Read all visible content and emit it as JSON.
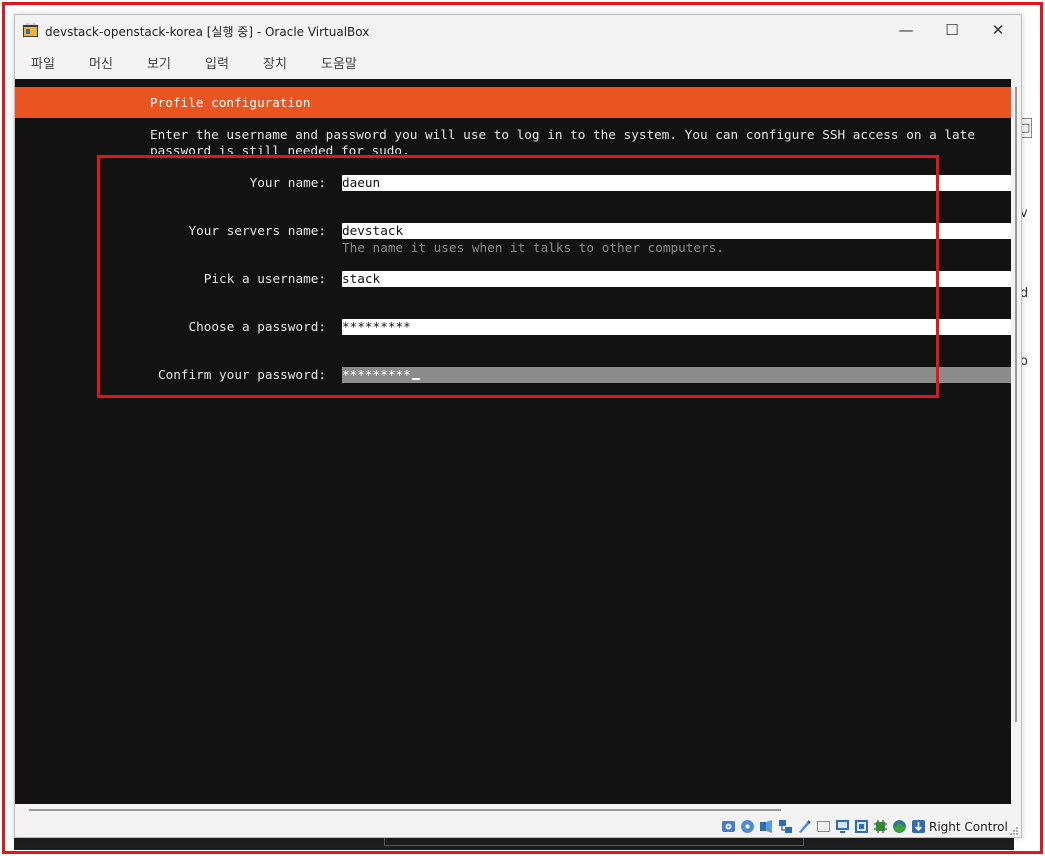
{
  "window": {
    "title": "devstack-openstack-korea [실행 중] - Oracle VirtualBox",
    "controls": {
      "minimize": "—",
      "maximize": "☐",
      "close": "✕"
    }
  },
  "menubar": {
    "items": [
      {
        "id": "file",
        "label": "파일"
      },
      {
        "id": "machine",
        "label": "머신"
      },
      {
        "id": "view",
        "label": "보기"
      },
      {
        "id": "input",
        "label": "입력"
      },
      {
        "id": "devices",
        "label": "장치"
      },
      {
        "id": "help",
        "label": "도움말"
      }
    ]
  },
  "installer": {
    "header_title": "Profile configuration",
    "intro_line1": "Enter the username and password you will use to log in to the system. You can configure SSH access on a late",
    "intro_line2": "password is still needed for sudo.",
    "fields": [
      {
        "id": "your-name",
        "label": "Your name:",
        "value": "daeun"
      },
      {
        "id": "server-name",
        "label": "Your servers name:",
        "value": "devstack",
        "hint": "The name it uses when it talks to other computers."
      },
      {
        "id": "username",
        "label": "Pick a username:",
        "value": "stack"
      },
      {
        "id": "password",
        "label": "Choose a password:",
        "value": "*********"
      },
      {
        "id": "confirm-password",
        "label": "Confirm your password:",
        "value": "*********"
      }
    ],
    "accent_color": "#e95420"
  },
  "desktop": {
    "right_fragments": [
      "□",
      "v",
      "d",
      "o"
    ]
  },
  "statusbar": {
    "host_key": "Right Control",
    "icons": [
      "hard-disk-icon",
      "optical-drive-icon",
      "audio-icon",
      "network-icon",
      "usb-icon",
      "shared-folder-icon",
      "display-icon",
      "video-capture-icon",
      "cpu-icon",
      "guest-additions-icon",
      "mouse-integration-icon"
    ]
  },
  "colors": {
    "annotation_red": "#e0161b",
    "vm_background": "#121212",
    "active_field": "#8c8c8c"
  }
}
